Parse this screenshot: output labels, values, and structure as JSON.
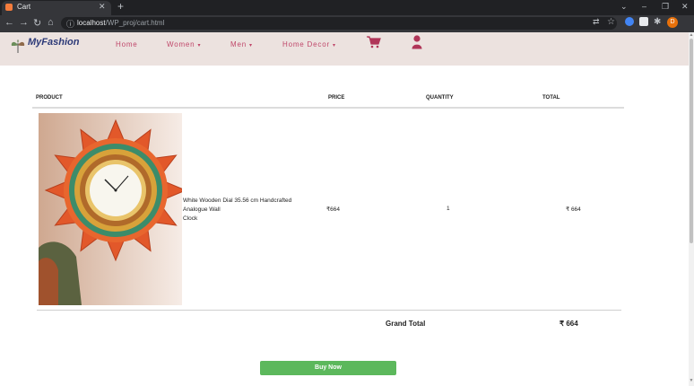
{
  "browser": {
    "tab_title": "Cart",
    "url_host": "localhost",
    "url_path": "/WP_proj/cart.html",
    "profile_initial": "D"
  },
  "header": {
    "brand": "MyFashion",
    "nav": [
      {
        "label": "Home"
      },
      {
        "label": "Women",
        "caret": "▾"
      },
      {
        "label": "Men",
        "caret": "▾"
      },
      {
        "label": "Home Decor",
        "caret": "▾"
      }
    ],
    "cart_icon": "shopping-cart-icon",
    "user_icon": "user-icon"
  },
  "cart": {
    "columns": [
      "PRODUCT",
      "PRICE",
      "QUANTITY",
      "TOTAL"
    ],
    "items": [
      {
        "name_line1": "White Wooden Dial 35.56 cm Handcrafted",
        "name_line2": "Analogue Wall",
        "name_line3": "Clock",
        "price": "₹664",
        "quantity": "1",
        "total": "₹ 664"
      }
    ],
    "grand_total_label": "Grand Total",
    "grand_total_value": "₹ 664",
    "buy_now_label": "Buy Now"
  },
  "colors": {
    "header_bg": "#ece2df",
    "nav_text": "#c0476a",
    "buy_button": "#5cb85c"
  }
}
